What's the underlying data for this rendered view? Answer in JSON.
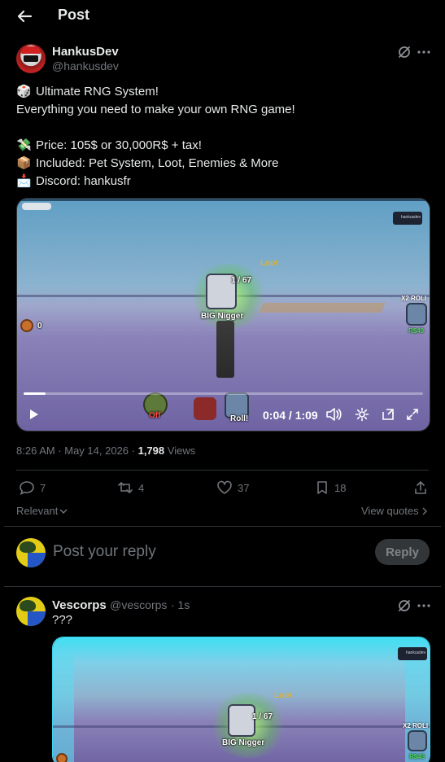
{
  "header": {
    "title": "Post"
  },
  "post": {
    "author_name": "HankusDev",
    "author_handle": "@hankusdev",
    "lines": [
      {
        "emoji": "🎲",
        "text": "Ultimate RNG System!"
      },
      {
        "emoji": "",
        "text": "Everything you need to make your own RNG game!"
      },
      {
        "emoji": "",
        "text": ""
      },
      {
        "emoji": "💸",
        "text": "Price: 105$ or 30,000R$ + tax!"
      },
      {
        "emoji": "📦",
        "text": "Included: Pet System, Loot, Enemies & More"
      },
      {
        "emoji": "📩",
        "text": "Discord: hankusfr"
      }
    ],
    "video": {
      "loot_label": "Loot",
      "counter": "1 / 67",
      "enemy_name": "BIG Nigger",
      "coin_value": "0",
      "x2_label": "X2 ROLI",
      "price_label": "R$49",
      "off_label": "Off",
      "roll_label": "Roll!",
      "time": "0:04 / 1:09",
      "progress_fraction": 0.055,
      "mini_window_label": "hankusdev"
    },
    "meta": {
      "time": "8:26 AM · May 14, 2026 ·",
      "views_count": "1,798",
      "views_label": "Views"
    },
    "actions": {
      "replies": "7",
      "reposts": "4",
      "likes": "37",
      "bookmarks": "18"
    }
  },
  "filters": {
    "sort_label": "Relevant",
    "view_quotes": "View quotes"
  },
  "composer": {
    "placeholder": "Post your reply",
    "reply_button": "Reply"
  },
  "reply": {
    "author_name": "Vescorps",
    "author_handle": "@vescorps",
    "age": "· 1s",
    "text": "???",
    "video": {
      "loot_label": "Loot",
      "counter": "1 / 67",
      "enemy_name": "BIG Nigger",
      "x2_label": "X2 ROLI",
      "price_label": "R$49",
      "mini_window_label": "hankusdev"
    }
  },
  "colors": {
    "background": "#000000",
    "text": "#e7e9ea",
    "muted": "#71767b",
    "divider": "#2f3336",
    "reply_button_bg": "#333639"
  }
}
